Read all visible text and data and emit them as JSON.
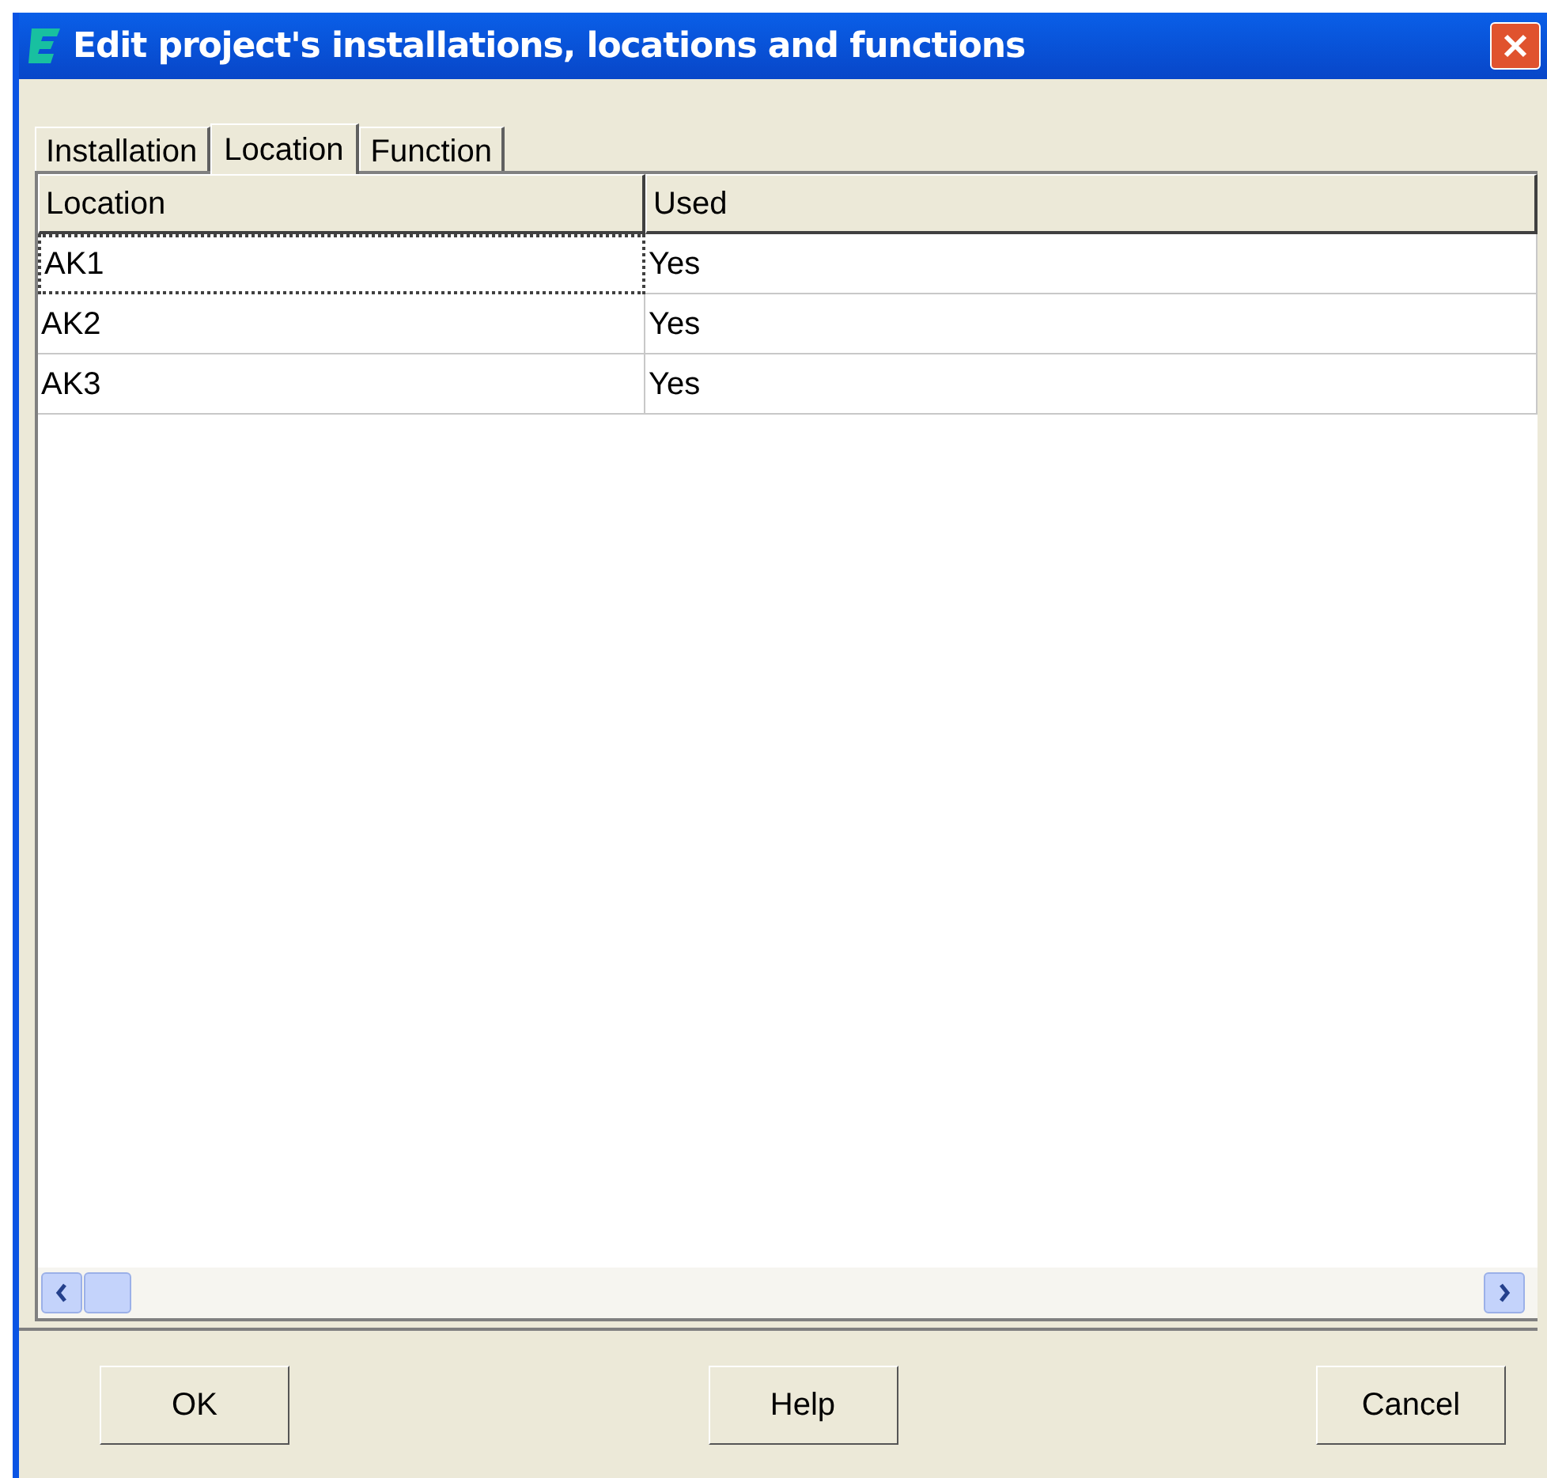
{
  "window": {
    "title": "Edit project's installations, locations and functions"
  },
  "tabs": [
    {
      "label": "Installation",
      "selected": false
    },
    {
      "label": "Location",
      "selected": true
    },
    {
      "label": "Function",
      "selected": false
    }
  ],
  "table": {
    "columns": [
      "Location",
      "Used"
    ],
    "rows": [
      {
        "cells": [
          "AK1",
          "Yes"
        ],
        "focused": true
      },
      {
        "cells": [
          "AK2",
          "Yes"
        ],
        "focused": false
      },
      {
        "cells": [
          "AK3",
          "Yes"
        ],
        "focused": false
      }
    ]
  },
  "buttons": [
    "OK",
    "Help",
    "Cancel"
  ]
}
